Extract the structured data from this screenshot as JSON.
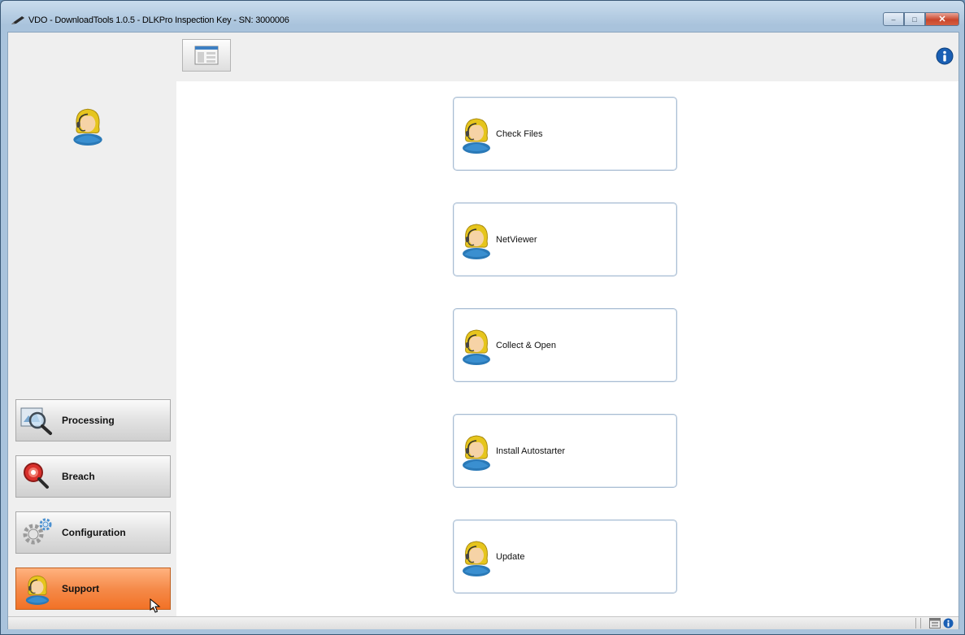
{
  "window": {
    "title": "VDO - DownloadTools 1.0.5 - DLKPro Inspection Key - SN: 3000006",
    "controls": {
      "minimize": "–",
      "maximize": "□",
      "close": "✕"
    }
  },
  "sidebar": {
    "avatar_icon": "support-agent-icon",
    "items": [
      {
        "label": "Processing",
        "icon": "magnifier-icon",
        "active": false
      },
      {
        "label": "Breach",
        "icon": "alert-magnifier-icon",
        "active": false
      },
      {
        "label": "Configuration",
        "icon": "gears-icon",
        "active": false
      },
      {
        "label": "Support",
        "icon": "support-agent-icon",
        "active": true
      }
    ]
  },
  "toolbar": {
    "layout_button_icon": "layout-icon",
    "info_button_icon": "info-icon"
  },
  "actions": [
    {
      "label": "Check Files"
    },
    {
      "label": "NetViewer"
    },
    {
      "label": "Collect & Open"
    },
    {
      "label": "Install Autostarter"
    },
    {
      "label": "Update"
    }
  ],
  "colors": {
    "active_nav": "#f27226",
    "card_border": "#a8bcd2",
    "info_blue": "#1a5fb4",
    "close_red": "#c9462c"
  }
}
